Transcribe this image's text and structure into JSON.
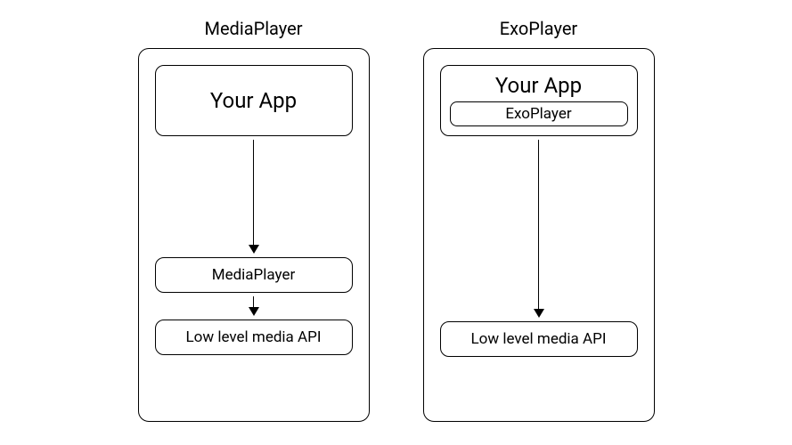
{
  "left": {
    "title": "MediaPlayer",
    "app_label": "Your App",
    "middle_label": "MediaPlayer",
    "bottom_label": "Low level media API"
  },
  "right": {
    "title": "ExoPlayer",
    "app_label": "Your App",
    "inner_label": "ExoPlayer",
    "bottom_label": "Low level media API"
  }
}
